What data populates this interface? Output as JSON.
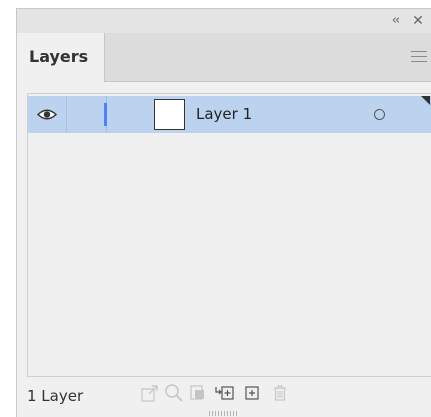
{
  "panel": {
    "tab_label": "Layers",
    "collapse_glyph": "‹‹",
    "close_glyph": "✕"
  },
  "layers": [
    {
      "name": "Layer 1",
      "visible": true,
      "selected": true,
      "color": "#4f80ff"
    }
  ],
  "footer": {
    "count_label": "1 Layer",
    "icons": [
      "export-icon",
      "locate-object-icon",
      "make-clipping-mask-icon",
      "create-sublayer-icon",
      "new-layer-icon",
      "delete-icon"
    ]
  },
  "colors": {
    "selected_row": "#bcd3ef",
    "layer_color": "#4f80ff",
    "panel_bg": "#f0f0f0"
  }
}
